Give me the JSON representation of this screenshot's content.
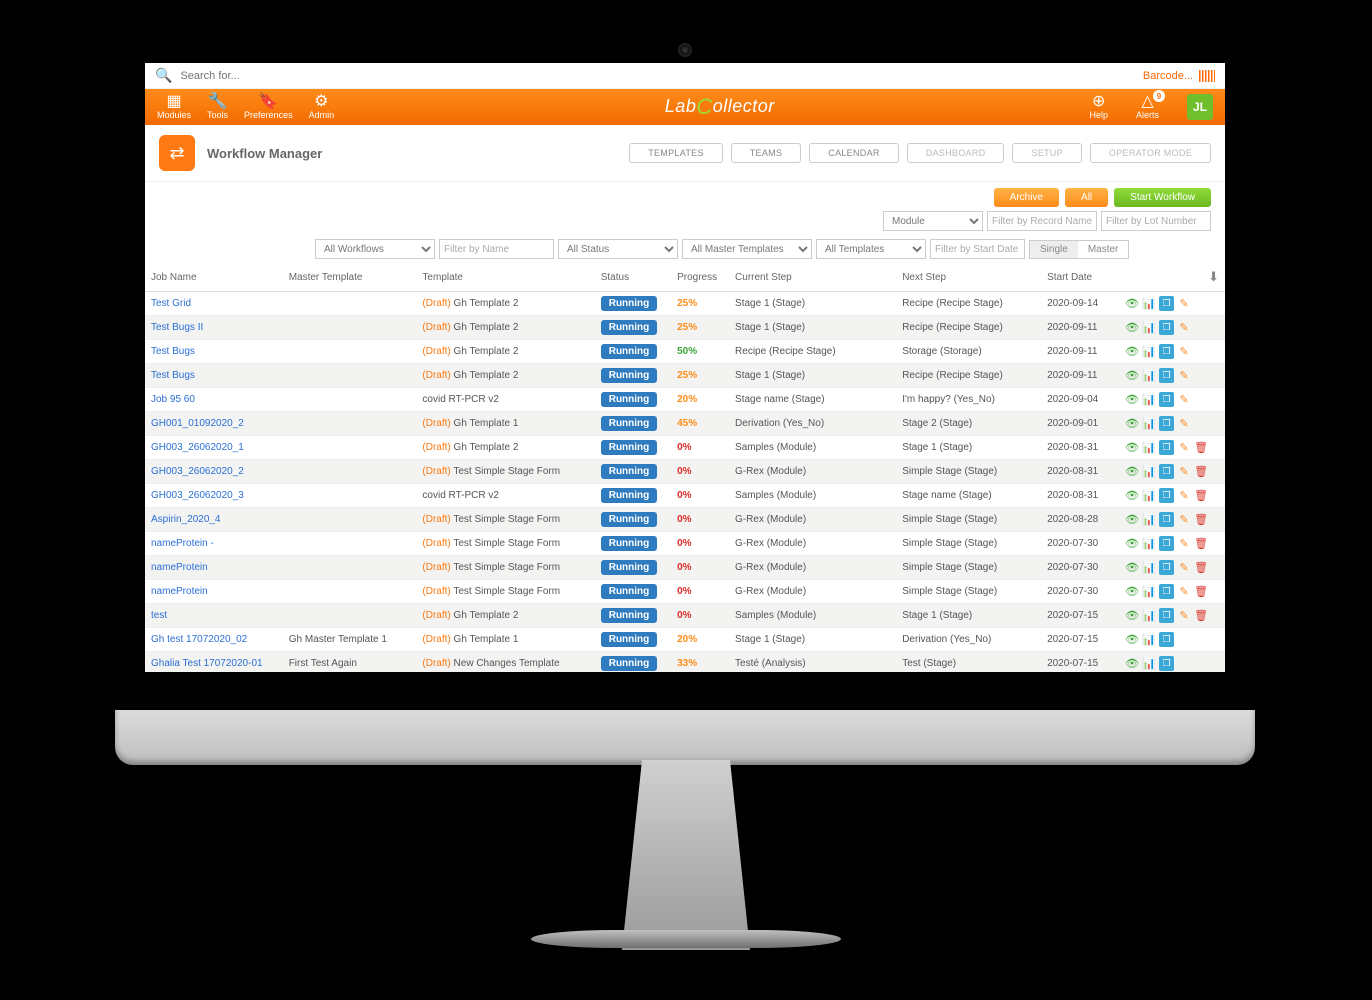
{
  "search": {
    "placeholder": "Search for...",
    "barcode_placeholder": "Barcode..."
  },
  "topnav": {
    "modules": "Modules",
    "tools": "Tools",
    "prefs": "Preferences",
    "admin": "Admin",
    "brand_prefix": "Lab",
    "brand_suffix": "ollector",
    "help": "Help",
    "alerts": "Alerts",
    "alerts_count": "9",
    "avatar": "JL"
  },
  "page": {
    "title": "Workflow Manager",
    "tabs": {
      "templates": "TEMPLATES",
      "teams": "TEAMS",
      "calendar": "CALENDAR",
      "dashboard": "DASHBOARD",
      "setup": "SETUP",
      "operator": "OPERATOR MODE"
    },
    "actions": {
      "archive": "Archive",
      "all": "All",
      "start": "Start Workflow"
    },
    "filters": {
      "module": "Module",
      "record_ph": "Filter by Record Name",
      "lot_ph": "Filter by Lot Number",
      "workflows": "All Workflows",
      "name_ph": "Filter by Name",
      "status": "All Status",
      "master": "All Master Templates",
      "templates": "All Templates",
      "date_ph": "Filter by Start Date",
      "toggle_single": "Single",
      "toggle_master": "Master"
    },
    "columns": {
      "job": "Job Name",
      "mt": "Master Template",
      "tpl": "Template",
      "status": "Status",
      "prog": "Progress",
      "cur": "Current Step",
      "next": "Next Step",
      "sd": "Start Date"
    }
  },
  "rows": [
    {
      "job": "Test Grid",
      "mt": "",
      "draft": true,
      "tpl": "Gh Template 2",
      "status": "Running",
      "prog": "25%",
      "pc": "o",
      "cur": "Stage 1 (Stage)",
      "next": "Recipe (Recipe Stage)",
      "date": "2020-09-14",
      "del": false
    },
    {
      "job": "Test Bugs II",
      "mt": "",
      "draft": true,
      "tpl": "Gh Template 2",
      "status": "Running",
      "prog": "25%",
      "pc": "o",
      "cur": "Stage 1 (Stage)",
      "next": "Recipe (Recipe Stage)",
      "date": "2020-09-11",
      "del": false
    },
    {
      "job": "Test Bugs",
      "mt": "",
      "draft": true,
      "tpl": "Gh Template 2",
      "status": "Running",
      "prog": "50%",
      "pc": "g",
      "cur": "Recipe (Recipe Stage)",
      "next": "Storage (Storage)",
      "date": "2020-09-11",
      "del": false
    },
    {
      "job": "Test Bugs",
      "mt": "",
      "draft": true,
      "tpl": "Gh Template 2",
      "status": "Running",
      "prog": "25%",
      "pc": "o",
      "cur": "Stage 1 (Stage)",
      "next": "Recipe (Recipe Stage)",
      "date": "2020-09-11",
      "del": false
    },
    {
      "job": "Job 95 60",
      "mt": "",
      "draft": false,
      "tpl": "covid RT-PCR v2",
      "status": "Running",
      "prog": "20%",
      "pc": "o",
      "cur": "Stage name (Stage)",
      "next": "I'm happy? (Yes_No)",
      "date": "2020-09-04",
      "del": false
    },
    {
      "job": "GH001_01092020_2",
      "mt": "",
      "draft": true,
      "tpl": "Gh Template 1",
      "status": "Running",
      "prog": "45%",
      "pc": "o",
      "cur": "Derivation (Yes_No)",
      "next": "Stage 2 (Stage)",
      "date": "2020-09-01",
      "del": false
    },
    {
      "job": "GH003_26062020_1",
      "mt": "",
      "draft": true,
      "tpl": "Gh Template 2",
      "status": "Running",
      "prog": "0%",
      "pc": "r",
      "cur": "Samples (Module)",
      "next": "Stage 1 (Stage)",
      "date": "2020-08-31",
      "del": true
    },
    {
      "job": "GH003_26062020_2",
      "mt": "",
      "draft": true,
      "tpl": "Test Simple Stage Form",
      "status": "Running",
      "prog": "0%",
      "pc": "r",
      "cur": "G-Rex (Module)",
      "next": "Simple Stage (Stage)",
      "date": "2020-08-31",
      "del": true
    },
    {
      "job": "GH003_26062020_3",
      "mt": "",
      "draft": false,
      "tpl": "covid RT-PCR v2",
      "status": "Running",
      "prog": "0%",
      "pc": "r",
      "cur": "Samples (Module)",
      "next": "Stage name (Stage)",
      "date": "2020-08-31",
      "del": true
    },
    {
      "job": "Aspirin_2020_4",
      "mt": "",
      "draft": true,
      "tpl": "Test Simple Stage Form",
      "status": "Running",
      "prog": "0%",
      "pc": "r",
      "cur": "G-Rex (Module)",
      "next": "Simple Stage (Stage)",
      "date": "2020-08-28",
      "del": true
    },
    {
      "job": "nameProtein -",
      "mt": "",
      "draft": true,
      "tpl": "Test Simple Stage Form",
      "status": "Running",
      "prog": "0%",
      "pc": "r",
      "cur": "G-Rex (Module)",
      "next": "Simple Stage (Stage)",
      "date": "2020-07-30",
      "del": true
    },
    {
      "job": "nameProtein",
      "mt": "",
      "draft": true,
      "tpl": "Test Simple Stage Form",
      "status": "Running",
      "prog": "0%",
      "pc": "r",
      "cur": "G-Rex (Module)",
      "next": "Simple Stage (Stage)",
      "date": "2020-07-30",
      "del": true
    },
    {
      "job": "nameProtein",
      "mt": "",
      "draft": true,
      "tpl": "Test Simple Stage Form",
      "status": "Running",
      "prog": "0%",
      "pc": "r",
      "cur": "G-Rex (Module)",
      "next": "Simple Stage (Stage)",
      "date": "2020-07-30",
      "del": true
    },
    {
      "job": "test",
      "mt": "",
      "draft": true,
      "tpl": "Gh Template 2",
      "status": "Running",
      "prog": "0%",
      "pc": "r",
      "cur": "Samples (Module)",
      "next": "Stage 1 (Stage)",
      "date": "2020-07-15",
      "del": true
    },
    {
      "job": "Gh test 17072020_02",
      "mt": "Gh Master Template 1",
      "draft": true,
      "tpl": "Gh Template 1",
      "status": "Running",
      "prog": "20%",
      "pc": "o",
      "cur": "Stage 1 (Stage)",
      "next": "Derivation (Yes_No)",
      "date": "2020-07-15",
      "del": false,
      "nopen": true
    },
    {
      "job": "Ghalia Test 17072020-01",
      "mt": "First Test Again",
      "draft": true,
      "tpl": "New Changes Template",
      "status": "Running",
      "prog": "33%",
      "pc": "o",
      "cur": "Testé (Analysis)",
      "next": "Test (Stage)",
      "date": "2020-07-15",
      "del": false,
      "nopen": true
    }
  ]
}
